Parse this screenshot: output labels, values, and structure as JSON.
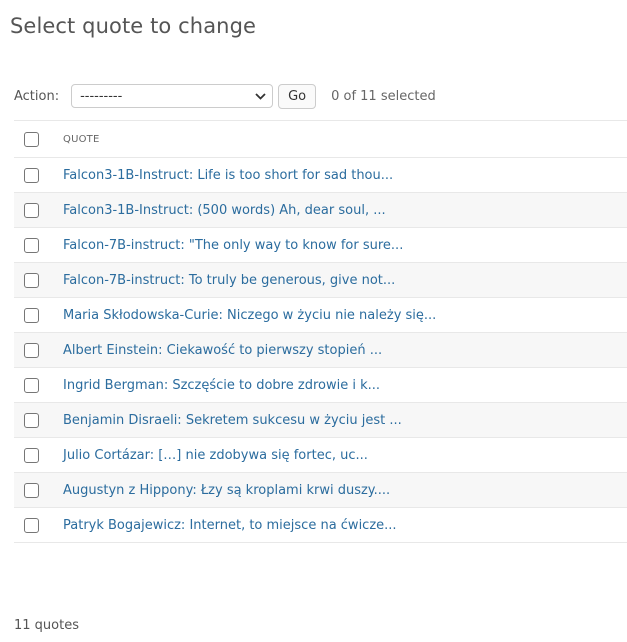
{
  "page": {
    "title": "Select quote to change"
  },
  "actions": {
    "label": "Action:",
    "select_value": "---------",
    "go_label": "Go",
    "selection_counter": "0 of 11 selected"
  },
  "table": {
    "column_header": "QUOTE",
    "rows": [
      "Falcon3-1B-Instruct: Life is too short for sad thou...",
      "Falcon3-1B-Instruct: (500 words) Ah, dear soul, ...",
      "Falcon-7B-instruct: \"The only way to know for sure...",
      "Falcon-7B-instruct: To truly be generous, give not...",
      "Maria Skłodowska-Curie: Niczego w życiu nie należy się...",
      "Albert Einstein: Ciekawość to pierwszy stopień ...",
      "Ingrid Bergman: Szczęście to dobre zdrowie i k...",
      "Benjamin Disraeli: Sekretem sukcesu w życiu jest ...",
      "Julio Cortázar: […] nie zdobywa się fortec, uc...",
      "Augustyn z Hippony: Łzy są kroplami krwi duszy....",
      "Patryk Bogajewicz: Internet, to miejsce na ćwicze..."
    ]
  },
  "paginator": {
    "text": "11 quotes"
  },
  "colors": {
    "link": "#2b6c9e",
    "border": "#e8e8e8",
    "row_alt": "#f7f7f7"
  },
  "icons": {
    "select_arrow": "chevron-down-icon"
  }
}
